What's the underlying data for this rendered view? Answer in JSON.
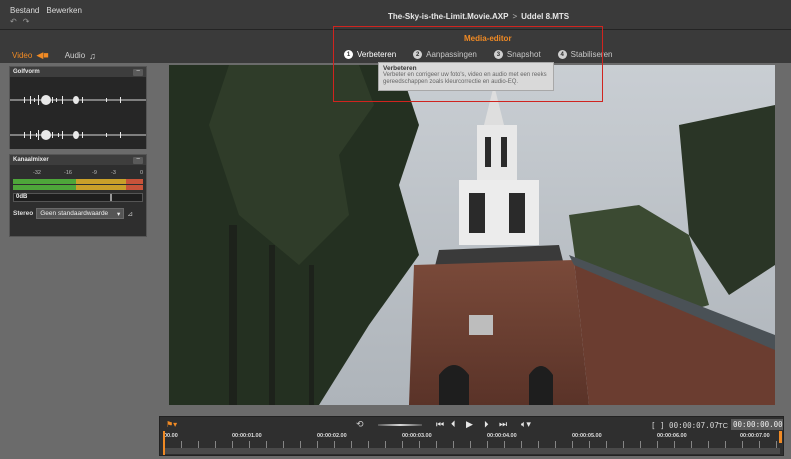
{
  "menu": {
    "file": "Bestand",
    "edit": "Bewerken"
  },
  "undo_icons": [
    "undo-icon",
    "redo-icon"
  ],
  "document": {
    "project": "The-Sky-is-the-Limit.Movie.AXP",
    "separator": ">",
    "clip": "Uddel 8.MTS"
  },
  "media_tabs": [
    {
      "label": "Video",
      "icon": "video-camera-icon",
      "active": true
    },
    {
      "label": "Audio",
      "icon": "music-note-icon",
      "active": false
    }
  ],
  "editor": {
    "title": "Media-editor",
    "steps": [
      {
        "num": "1",
        "label": "Verbeteren",
        "active": true
      },
      {
        "num": "2",
        "label": "Aanpassingen",
        "active": false
      },
      {
        "num": "3",
        "label": "Snapshot",
        "active": false
      },
      {
        "num": "4",
        "label": "Stabiliseren",
        "active": false
      }
    ]
  },
  "tooltip": {
    "title": "Verbeteren",
    "body": "Verbeter en corrigeer uw foto's, video en audio met een reeks gereedschappen zoals kleurcorrectie en audio-EQ."
  },
  "waveform_panel": {
    "title": "Golfvorm",
    "collapse": "−"
  },
  "mixer_panel": {
    "title": "Kanaalmixer",
    "collapse": "−",
    "scale": [
      "-32",
      "-16",
      "-9",
      "-3",
      "0"
    ],
    "volume": "0dB",
    "stereo_label": "Stereo",
    "stereo_value": "Geen standaardwaarde",
    "colors": {
      "green": "#4ea63a",
      "yellow": "#c9a02a",
      "red": "#c8533a"
    }
  },
  "transport": {
    "timecode_inout": "[ ] 00:00:07.07",
    "tc_label": "TC",
    "timecode": "00:00:00.00",
    "ruler": [
      "00.00",
      "00:00:01.00",
      "00:00:02.00",
      "00:00:03.00",
      "00:00:04.00",
      "00:00:05.00",
      "00:00:06.00",
      "00:00:07.00"
    ]
  },
  "accent": "#f08a24"
}
